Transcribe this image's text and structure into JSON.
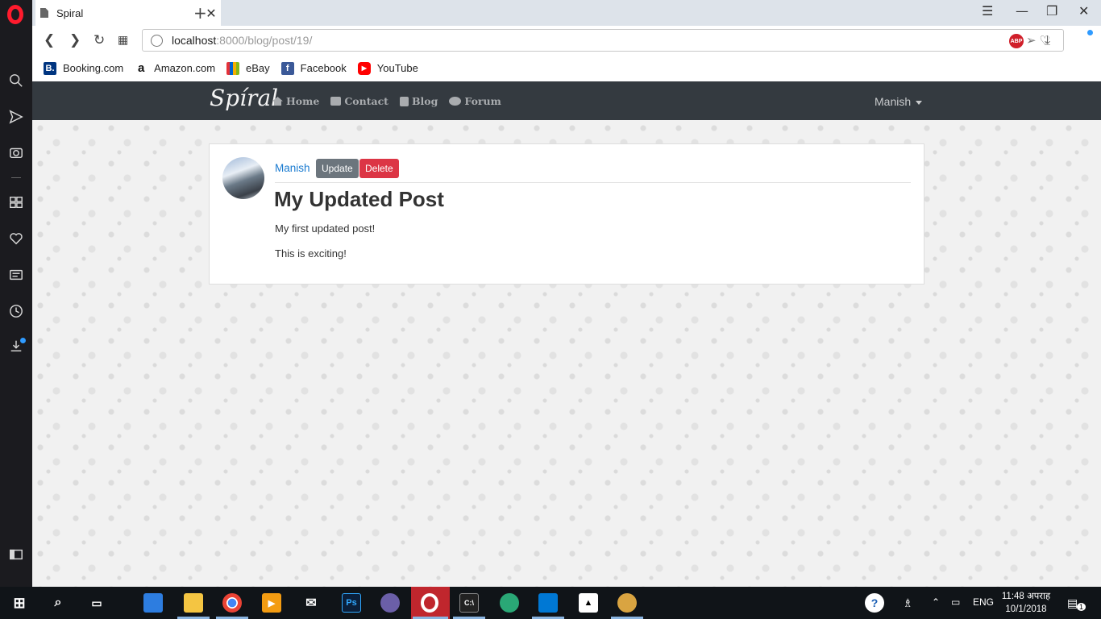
{
  "browser": {
    "tab_title": "Spiral",
    "url_host": "localhost",
    "url_path": ":8000/blog/post/19/",
    "abp_label": "ABP",
    "bookmarks": [
      {
        "label": "Booking.com",
        "icon": "booking-icon",
        "icon_char": "B.",
        "color": "#003580"
      },
      {
        "label": "Amazon.com",
        "icon": "amazon-icon",
        "icon_char": "a",
        "color": "#ffffff"
      },
      {
        "label": "eBay",
        "icon": "ebay-icon",
        "icon_char": "",
        "color": "#e53238"
      },
      {
        "label": "Facebook",
        "icon": "facebook-icon",
        "icon_char": "f",
        "color": "#3b5998"
      },
      {
        "label": "YouTube",
        "icon": "youtube-icon",
        "icon_char": "▶",
        "color": "#ff0000"
      }
    ]
  },
  "site": {
    "brand": "Spíral",
    "nav": [
      {
        "label": "Home",
        "icon": "home-icon"
      },
      {
        "label": "Contact",
        "icon": "envelope-icon"
      },
      {
        "label": "Blog",
        "icon": "blog-icon"
      },
      {
        "label": "Forum",
        "icon": "comments-icon"
      }
    ],
    "user": "Manish"
  },
  "post": {
    "author": "Manish",
    "update_label": "Update",
    "delete_label": "Delete",
    "title": "My Updated Post",
    "paragraphs": [
      "My first updated post!",
      "This is exciting!"
    ]
  },
  "taskbar": {
    "lang": "ENG",
    "time": "11:48 अपराह",
    "date": "10/1/2018",
    "notification_count": "1"
  },
  "colors": {
    "navbar": "#343a40",
    "link": "#1a7bd0",
    "update_button": "#6c757d",
    "delete_button": "#dc3545",
    "opera_red": "#ff1b2d"
  }
}
